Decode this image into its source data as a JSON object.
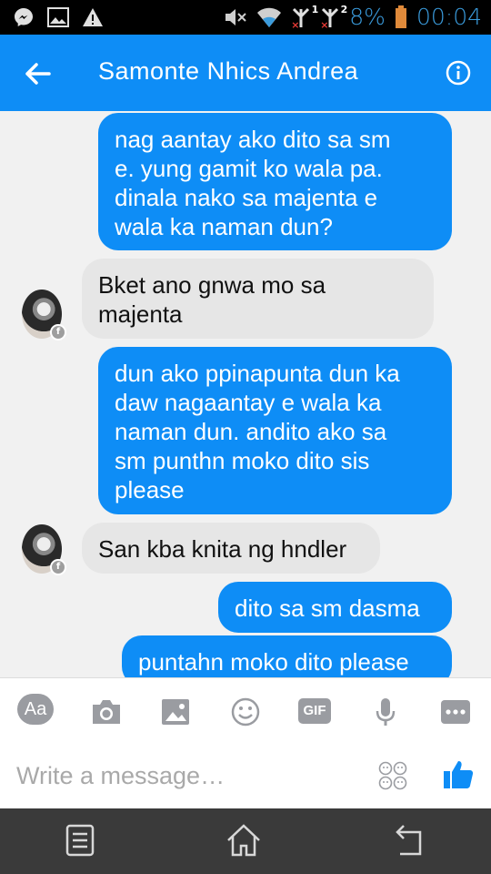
{
  "status_bar": {
    "battery_percent": "8%",
    "time": "00:04",
    "sim1": "1",
    "sim2": "2",
    "icons": [
      "messenger-icon",
      "gallery-icon",
      "warning-icon",
      "mute-icon",
      "wifi-icon",
      "signal-icon",
      "battery-icon"
    ]
  },
  "header": {
    "title": "Samonte Nhics Andrea"
  },
  "messages": [
    {
      "from": "me",
      "text": "nag aantay ako dito sa sm\ne. yung gamit ko wala pa.\ndinala nako sa majenta e\nwala ka naman dun?"
    },
    {
      "from": "them",
      "text": "Bket ano gnwa mo sa\nmajenta"
    },
    {
      "from": "me",
      "text": "dun ako ppinapunta dun ka\ndaw nagaantay e wala ka\nnaman dun. andito ako sa\nsm punthn moko dito sis\nplease"
    },
    {
      "from": "them",
      "text": "San kba knita ng hndler"
    },
    {
      "from": "me",
      "text": "dito sa sm dasma"
    },
    {
      "from": "me",
      "text": "puntahn moko dito please"
    }
  ],
  "toolbar": {
    "aa_label": "Aa",
    "gif_label": "GIF"
  },
  "composer": {
    "placeholder": "Write a message…"
  },
  "colors": {
    "accent": "#0e8df6",
    "incoming_bubble": "#e6e6e6",
    "background": "#f1f1f1"
  }
}
